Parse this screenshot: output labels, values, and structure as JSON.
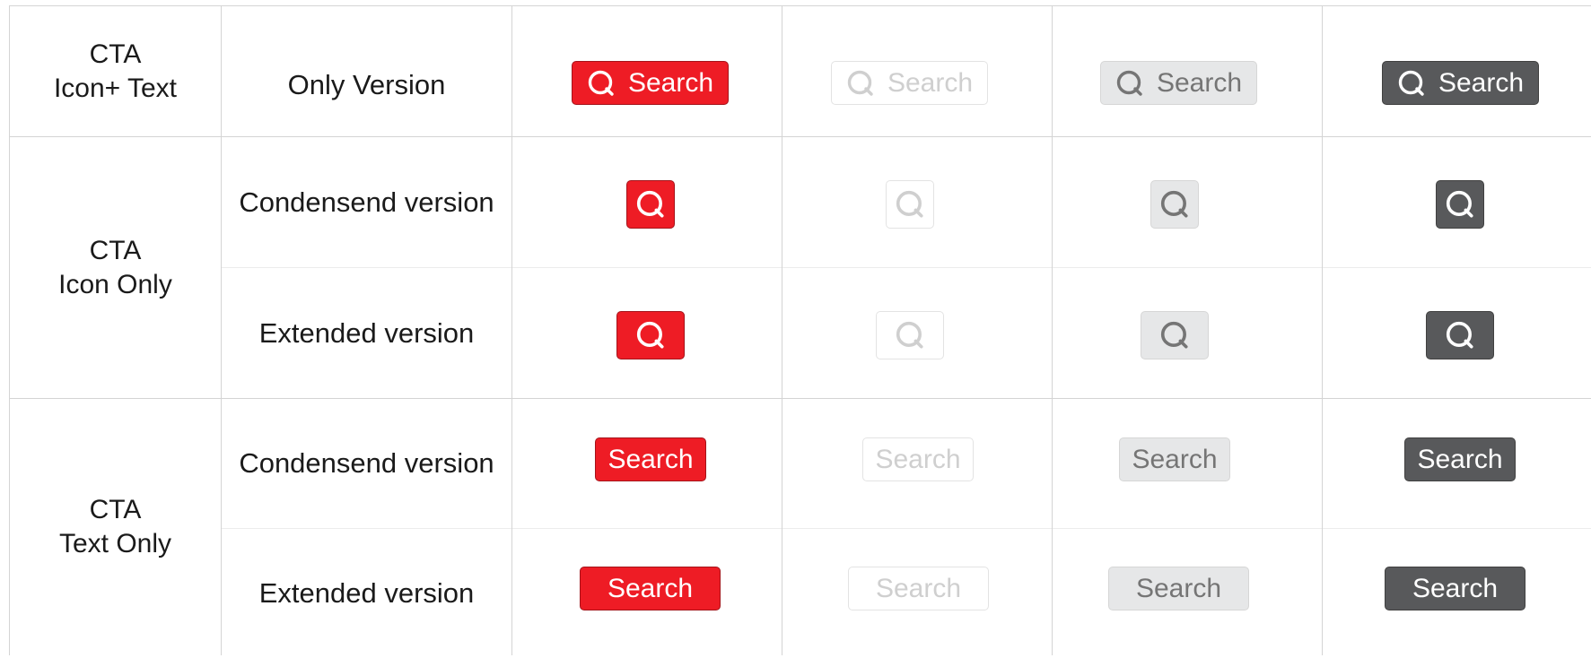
{
  "groups": [
    {
      "line1": "CTA",
      "line2": "Icon+ Text"
    },
    {
      "line1": "CTA",
      "line2": "Icon Only"
    },
    {
      "line1": "CTA",
      "line2": "Text Only"
    }
  ],
  "variants": [
    "Only Version",
    "Condensend version",
    "Extended version",
    "Condensend version",
    "Extended version"
  ],
  "button_label": "Search",
  "icon": "search-icon",
  "states": [
    {
      "name": "red",
      "background": "#ee1c25",
      "text": "#ffffff"
    },
    {
      "name": "light",
      "background": "#ffffff",
      "text": "#cfcfcf"
    },
    {
      "name": "gray",
      "background": "#e6e7e8",
      "text": "#757575"
    },
    {
      "name": "dark",
      "background": "#58595b",
      "text": "#ffffff"
    }
  ]
}
